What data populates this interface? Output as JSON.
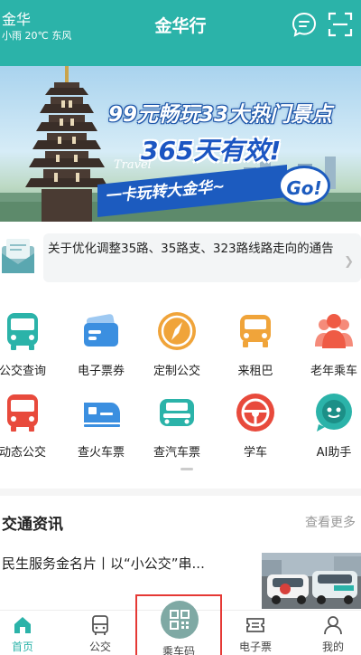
{
  "header": {
    "city": "金华",
    "weather": "小雨 20℃ 东风",
    "title": "金华行",
    "bg_color": "#2bb3a9",
    "icons": [
      "chat-icon",
      "scan-icon"
    ]
  },
  "banner": {
    "line1": "99元畅玩33大热门景点",
    "line2": "365天有效!",
    "travel": "Travel",
    "line3": "一卡玩转大金华~",
    "go": "Go!",
    "slide_count": 2,
    "active_slide": 1
  },
  "notice": {
    "text": "关于优化调整35路、35路支、323路线路走向的通告",
    "icon": "mail-icon"
  },
  "services": {
    "row1": [
      {
        "label": "公交查询",
        "icon": "bus-icon"
      },
      {
        "label": "电子票券",
        "icon": "ticket-icon"
      },
      {
        "label": "定制公交",
        "icon": "compass-icon"
      },
      {
        "label": "来租巴",
        "icon": "van-icon"
      },
      {
        "label": "老年乘车",
        "icon": "people-icon"
      }
    ],
    "row2": [
      {
        "label": "动态公交",
        "icon": "live-bus-icon"
      },
      {
        "label": "查火车票",
        "icon": "train-icon"
      },
      {
        "label": "查汽车票",
        "icon": "car-icon"
      },
      {
        "label": "学车",
        "icon": "steering-wheel-icon"
      },
      {
        "label": "AI助手",
        "icon": "ai-chat-icon"
      }
    ]
  },
  "news": {
    "section_title": "交通资讯",
    "more": "查看更多",
    "items": [
      {
        "title": "民生服务金名片丨以“小公交”串..."
      }
    ]
  },
  "tabbar": {
    "accent": "#2bb3a9",
    "tabs": [
      {
        "label": "首页",
        "icon": "home-icon",
        "active": true
      },
      {
        "label": "公交",
        "icon": "bus-tab-icon",
        "active": false
      },
      {
        "label": "乘车码",
        "icon": "qr-code-icon",
        "active": false
      },
      {
        "label": "电子票",
        "icon": "e-ticket-icon",
        "active": false
      },
      {
        "label": "我的",
        "icon": "profile-icon",
        "active": false
      }
    ]
  }
}
